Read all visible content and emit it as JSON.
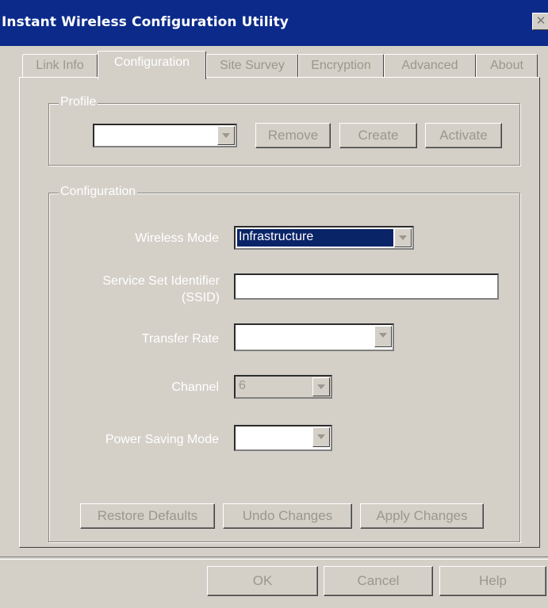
{
  "window": {
    "title": "Instant Wireless Configuration Utility",
    "close_glyph": "✕"
  },
  "tabs": [
    "Link Info",
    "Configuration",
    "Site Survey",
    "Encryption",
    "Advanced",
    "About"
  ],
  "profile": {
    "legend": "Profile",
    "selected": "",
    "buttons": {
      "remove": "Remove",
      "create": "Create",
      "activate": "Activate"
    }
  },
  "configuration": {
    "legend": "Configuration",
    "wireless_mode": {
      "label": "Wireless Mode",
      "value": "Infrastructure"
    },
    "ssid": {
      "label_line1": "Service Set Identifier",
      "label_line2": "(SSID)",
      "value": ""
    },
    "transfer_rate": {
      "label": "Transfer Rate",
      "value": ""
    },
    "channel": {
      "label": "Channel",
      "value": "6"
    },
    "power_saving": {
      "label": "Power Saving Mode",
      "value": ""
    },
    "buttons": {
      "restore": "Restore Defaults",
      "undo": "Undo Changes",
      "apply": "Apply Changes"
    }
  },
  "footer": {
    "ok": "OK",
    "cancel": "Cancel",
    "help": "Help"
  },
  "colors": {
    "titlebar": "#0b2a8a",
    "face": "#d4d0c8",
    "selection": "#0a2468",
    "disabled_text": "#9a978f"
  }
}
